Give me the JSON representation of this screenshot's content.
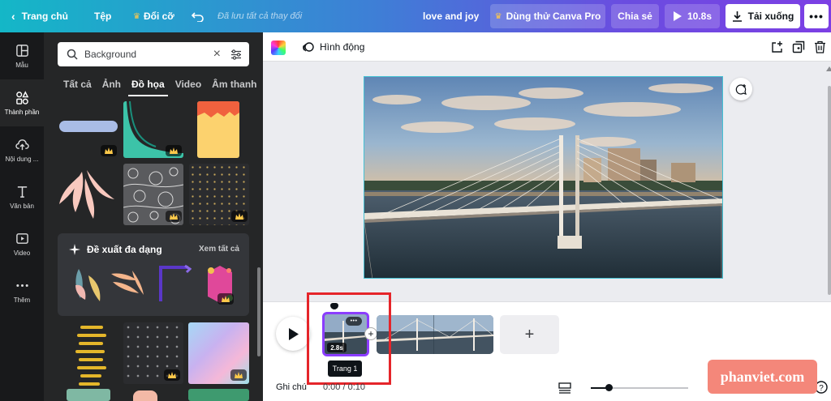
{
  "topbar": {
    "home": "Trang chủ",
    "file": "Tệp",
    "resize": "Đổi cỡ",
    "saved_status": "Đã lưu tất cả thay đổi",
    "project_title": "love and joy",
    "try_pro": "Dùng thử Canva Pro",
    "share": "Chia sẻ",
    "play_duration": "10.8s",
    "download": "Tải xuống"
  },
  "rail": {
    "items": [
      {
        "label": "Mẫu",
        "icon": "layout-icon"
      },
      {
        "label": "Thành phần",
        "icon": "shapes-icon"
      },
      {
        "label": "Nội dung ...",
        "icon": "cloud-upload-icon"
      },
      {
        "label": "Văn bản",
        "icon": "text-icon"
      },
      {
        "label": "Video",
        "icon": "video-icon"
      },
      {
        "label": "Thêm",
        "icon": "more-icon"
      }
    ]
  },
  "panel": {
    "search_value": "Background",
    "tabs": [
      "Tất cả",
      "Ảnh",
      "Đồ họa",
      "Video",
      "Âm thanh"
    ],
    "active_tab": "Đồ họa",
    "suggest_title": "Đề xuất đa dạng",
    "see_all": "Xem tất cả"
  },
  "context_bar": {
    "animate": "Hình động"
  },
  "timeline": {
    "clip1_duration": "2.8s",
    "page_tooltip": "Trang 1",
    "notes": "Ghi chú",
    "time": "0:00 / 0:10"
  },
  "watermark": "phanviet.com",
  "colors": {
    "brand_gradient_start": "#14b7c7",
    "brand_gradient_end": "#7c3fe4",
    "selection": "#8b3dff",
    "highlight_box": "#e5252a",
    "watermark_bg": "#f4877a"
  }
}
